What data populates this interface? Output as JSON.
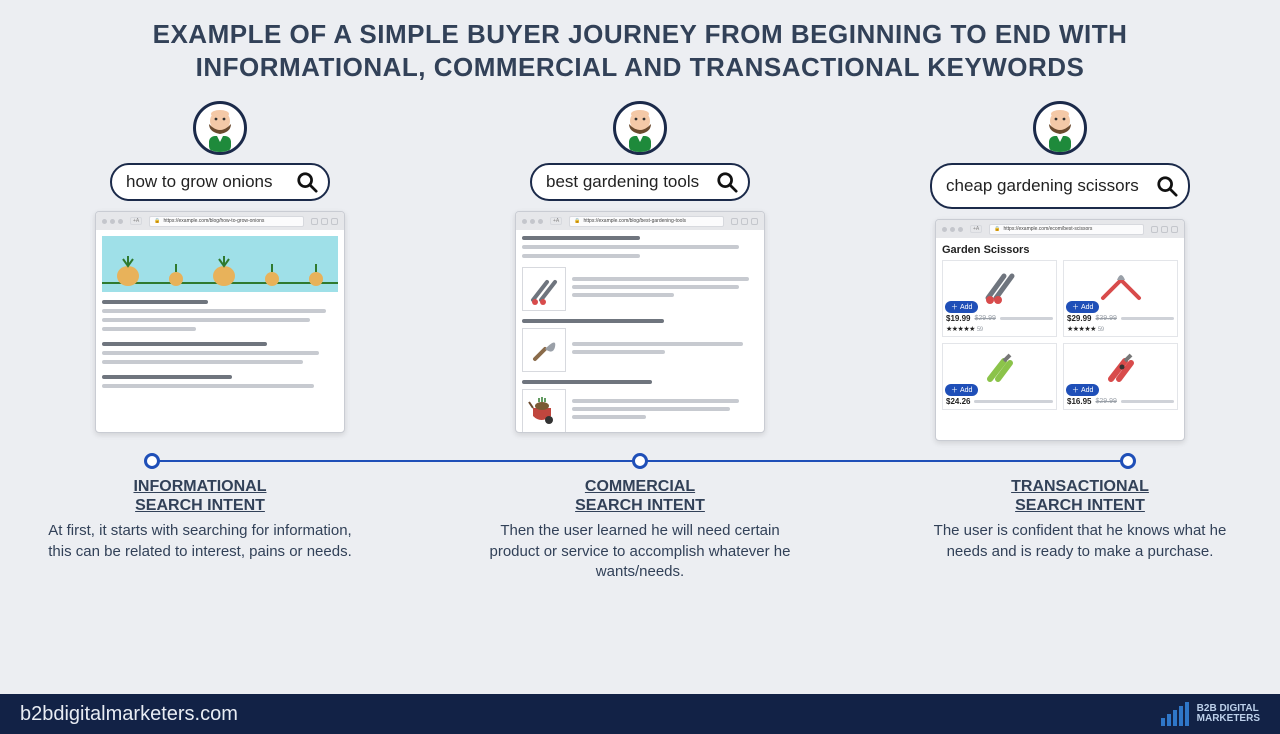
{
  "title": "EXAMPLE OF A SIMPLE BUYER JOURNEY FROM BEGINNING TO END WITH INFORMATIONAL, COMMERCIAL AND TRANSACTIONAL KEYWORDS",
  "stages": [
    {
      "search_query": "how to grow onions",
      "browser_url": "https://example.com/blog/how-to-grow-onions",
      "caption_heading_l1": "INFORMATIONAL",
      "caption_heading_l2": "SEARCH INTENT",
      "caption_desc": "At first, it starts with searching for information, this can be related to interest, pains or needs."
    },
    {
      "search_query": "best gardening tools",
      "browser_url": "https://example.com/blog/best-gardening-tools",
      "caption_heading_l1": "COMMERCIAL",
      "caption_heading_l2": "SEARCH INTENT",
      "caption_desc": "Then the user learned he will need certain product or service to accomplish whatever he wants/needs."
    },
    {
      "search_query": "cheap gardening scissors",
      "browser_url": "https://example.com/ecom/best-scissors",
      "caption_heading_l1": "TRANSACTIONAL",
      "caption_heading_l2": "SEARCH INTENT",
      "caption_desc": "The user is confident that he knows what he needs and is ready to make a purchase."
    }
  ],
  "ecom": {
    "title": "Garden Scissors",
    "add_label": "Add",
    "products": [
      {
        "price": "$19.99",
        "old_price": "$29.99",
        "rating": "★★★★★",
        "count": "59"
      },
      {
        "price": "$29.99",
        "old_price": "$39.99",
        "rating": "★★★★★",
        "count": "59"
      },
      {
        "price": "$24.26",
        "old_price": ""
      },
      {
        "price": "$16.95",
        "old_price": "$29.99"
      }
    ]
  },
  "footer": {
    "domain": "b2bdigitalmarketers.com",
    "logo_l1": "B2B DIGITAL",
    "logo_l2": "MARKETERS"
  }
}
